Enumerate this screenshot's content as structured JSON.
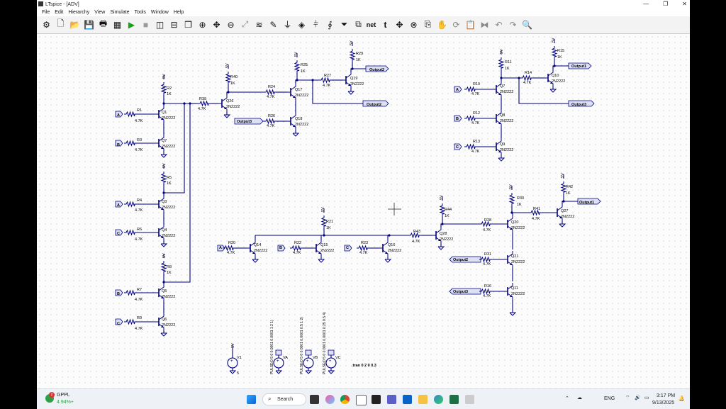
{
  "window": {
    "title": "LTspice - [ADV]"
  },
  "menu": [
    "File",
    "Edit",
    "Hierarchy",
    "View",
    "Simulate",
    "Tools",
    "Window",
    "Help"
  ],
  "toolbar": {
    "net_label": "net",
    "t_label": "t"
  },
  "schematic": {
    "supply": "5V",
    "resistors": {
      "R1": "4.7K",
      "R2": "1K",
      "R3": "4.7K",
      "R4": "4.7K",
      "R5": "1K",
      "R6": "4.7K",
      "R7": "4.7K",
      "R8": "1K",
      "R9": "4.7K",
      "R10": "4.7K",
      "R11": "1K",
      "R12": "4.7K",
      "R13": "4.7K",
      "R14": "4.7K",
      "R15": "1K",
      "R16": "4.7K",
      "R20": "4.7K",
      "R21": "1K",
      "R22": "4.7K",
      "R23": "4.7K",
      "R24": "4.7K",
      "R25": "1K",
      "R26": "4.7K",
      "R27": "4.7K",
      "R28": "4.7K",
      "R29": "1K",
      "R30": "1K",
      "R31": "4.7K",
      "R39": "4.7K",
      "R40": "1K",
      "R41": "4.7K",
      "R42": "1K",
      "R43": "4.7K",
      "R44": "1K"
    },
    "transistor_model": "2N2222",
    "transistors": [
      "Q1",
      "Q2",
      "Q3",
      "Q4",
      "Q5",
      "Q6",
      "Q7",
      "Q8",
      "Q9",
      "Q10",
      "Q11",
      "Q14",
      "Q15",
      "Q16",
      "Q17",
      "Q18",
      "Q19",
      "Q20",
      "Q21",
      "Q26",
      "Q27",
      "Q28"
    ],
    "inputs": [
      "A",
      "B",
      "C"
    ],
    "outputs": [
      "Output1",
      "Output2",
      "Output3"
    ],
    "sources": {
      "v1": "V1",
      "v1_value": "5",
      "va": "VA",
      "va_pulse": "PULSE(0 5 0 0.0001 0.0001 1 2 1)",
      "vb": "VB",
      "vb_pulse": "PULSE(0 5 0 0.0001 0.0001 0.5 1 2)",
      "vc": "VC",
      "vc_pulse": "PULSE(0 5 0 0.0001 0.0001 0.25 0.5 4)"
    },
    "directive": ".tran 0 2 0 0.3"
  },
  "taskbar": {
    "notify_badge": "2",
    "stock_name": "GPPL",
    "stock_change": "4.94%+",
    "search_placeholder": "Search",
    "language": "ENG",
    "time": "3:17 PM",
    "date": "9/13/2025"
  },
  "colors": {
    "wire": "#000080",
    "label_fill": "#dde0f5",
    "canvas": "#fcfcfc"
  }
}
